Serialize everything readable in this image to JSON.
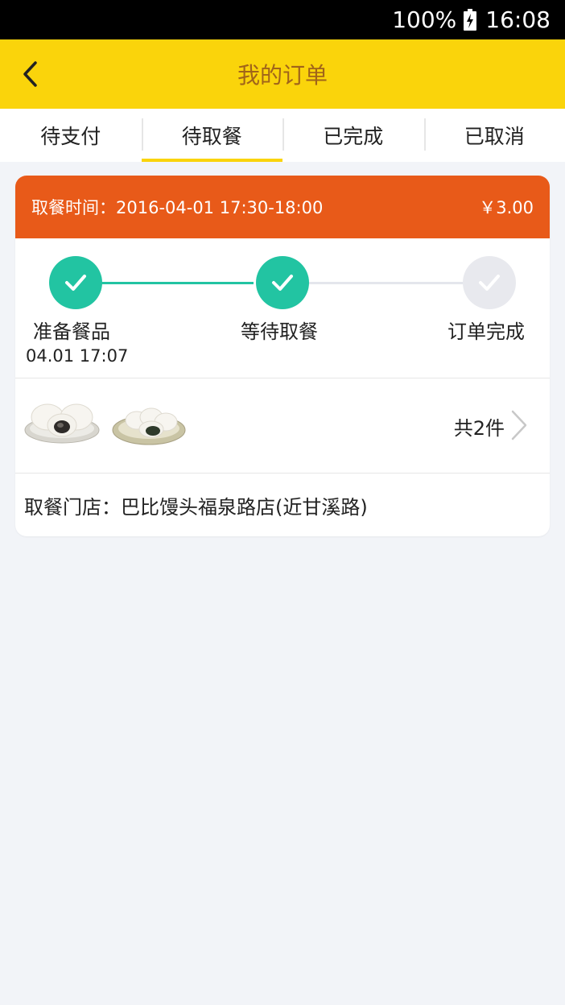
{
  "status_bar": {
    "battery_percent": "100%",
    "time": "16:08"
  },
  "app_bar": {
    "title": "我的订单",
    "back_icon": "back-chevron-icon"
  },
  "tabs": [
    {
      "label": "待支付",
      "active": false
    },
    {
      "label": "待取餐",
      "active": true
    },
    {
      "label": "已完成",
      "active": false
    },
    {
      "label": "已取消",
      "active": false
    }
  ],
  "order": {
    "pickup_time": "取餐时间：2016-04-01 17:30-18:00",
    "price": "￥3.00",
    "steps": [
      {
        "label": "准备餐品",
        "time": "04.01 17:07",
        "state": "done"
      },
      {
        "label": "等待取餐",
        "state": "done"
      },
      {
        "label": "订单完成",
        "state": "todo"
      }
    ],
    "item_count": "共2件",
    "store": "取餐门店：巴比馒头福泉路店(近甘溪路)"
  },
  "colors": {
    "accent": "#fad40b",
    "header": "#e85a19",
    "progress_done": "#22c4a2",
    "progress_todo": "#e8e9ee"
  }
}
